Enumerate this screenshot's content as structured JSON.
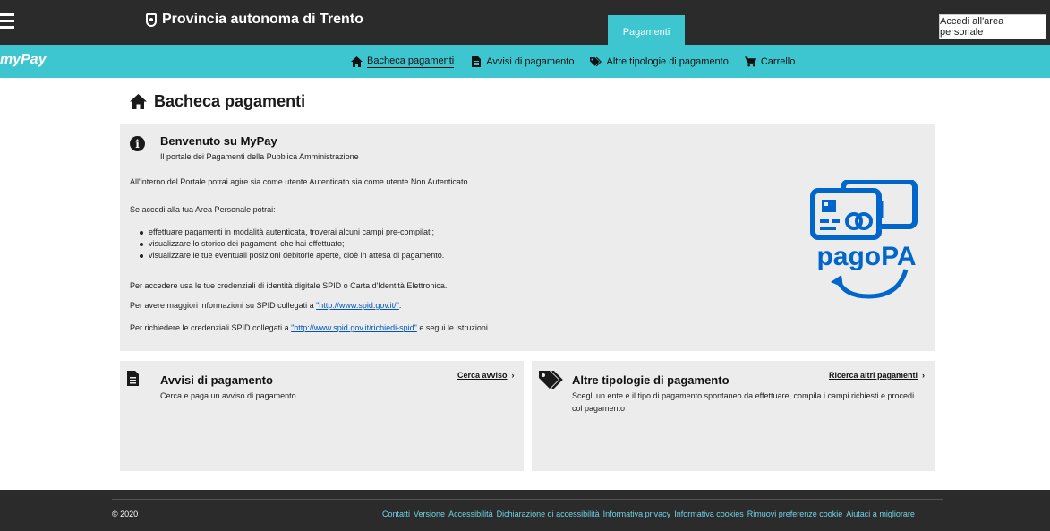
{
  "topbar": {
    "brand": "Provincia autonoma di Trento",
    "active_tab": "Pagamenti",
    "personal_area_button": "Accedi all'area personale"
  },
  "navbar": {
    "logo_my": "my",
    "logo_pay": "Pay",
    "items": [
      {
        "label": "Bacheca pagamenti",
        "icon": "home-icon",
        "active": true
      },
      {
        "label": "Avvisi di pagamento",
        "icon": "document-icon",
        "active": false
      },
      {
        "label": "Altre tipologie di pagamento",
        "icon": "tag-icon",
        "active": false
      },
      {
        "label": "Carrello",
        "icon": "cart-icon",
        "active": false
      }
    ]
  },
  "page": {
    "title": "Bacheca pagamenti"
  },
  "welcome": {
    "heading": "Benvenuto su MyPay",
    "subtitle": "Il portale dei Pagamenti della Pubblica Amministrazione",
    "intro": "All'interno del Portale potrai agire sia come utente Autenticato sia come utente Non Autenticato.",
    "area_intro": "Se accedi alla tua Area Personale potrai:",
    "bullets": [
      "effettuare pagamenti in modalità autenticata, troverai alcuni campi pre-compilati;",
      "visualizzare lo storico dei pagamenti che hai effettuato;",
      "visualizzare le tue eventuali posizioni debitorie aperte, cioè in attesa di pagamento."
    ],
    "credentials": "Per accedere usa le tue credenziali di identità digitale SPID o Carta d'Identità Elettronica.",
    "spid_info_prefix": "Per avere maggiori informazioni su SPID collegati a ",
    "spid_info_link": "\"http://www.spid.gov.it/\"",
    "spid_info_suffix": ".",
    "spid_request_prefix": "Per richiedere le credenziali SPID collegati a ",
    "spid_request_link": "\"http://www.spid.gov.it/richiedi-spid\"",
    "spid_request_suffix": " e segui le istruzioni.",
    "pagopa_label": "pagoPA"
  },
  "cards": {
    "avvisi": {
      "title": "Avvisi di pagamento",
      "description": "Cerca e paga un avviso di pagamento",
      "link": "Cerca avviso"
    },
    "altre": {
      "title": "Altre tipologie di pagamento",
      "description": "Scegli un ente e il tipo di pagamento spontaneo da effettuare, compila i campi richiesti e procedi col pagamento",
      "link": "Ricerca altri pagamenti"
    }
  },
  "footer": {
    "copyright": "© 2020",
    "links": [
      "Contatti",
      "Versione",
      "Accessibilità",
      "Dichiarazione di accessibilità",
      "Informativa privacy",
      "Informativa cookies",
      "Rimuovi preferenze cookie",
      "Aiutaci a migliorare"
    ]
  },
  "colors": {
    "topbar": "#2b2b2b",
    "accent": "#3ec6d0",
    "panel": "#ececec",
    "pagopa_blue": "#0066cc",
    "footer_link": "#6fd3e8"
  }
}
